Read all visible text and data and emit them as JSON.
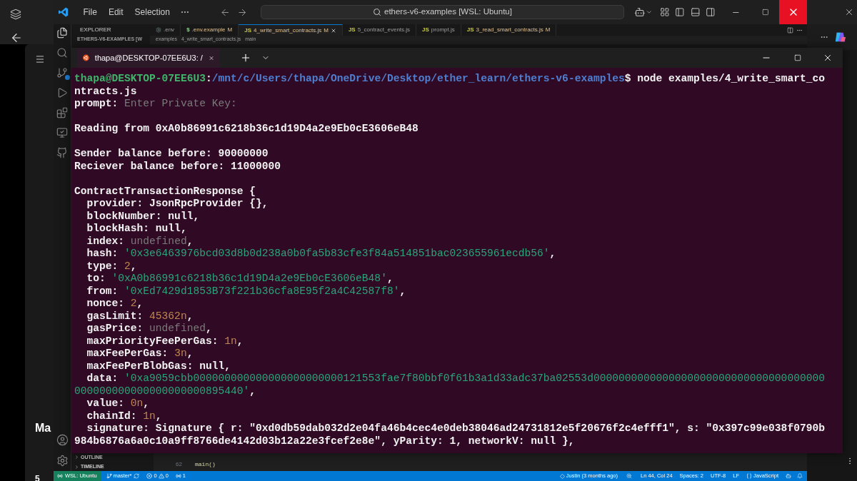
{
  "left_panel": {
    "heading": "Ma",
    "footer": "5"
  },
  "menu": [
    "File",
    "Edit",
    "Selection"
  ],
  "command_center": {
    "value": "ethers-v6-examples [WSL: Ubuntu]"
  },
  "sidebar": {
    "title": "EXPLORER",
    "folder": "ETHERS-V6-EXAMPLES [W",
    "sections": [
      "OUTLINE",
      "TIMELINE"
    ]
  },
  "editor_tabs": [
    {
      "label": ".env",
      "selected": false
    },
    {
      "label": ".env.example",
      "glyph": "$",
      "status": "M",
      "selected": false
    },
    {
      "label": "4_write_smart_contracts.js",
      "glyph": "JS",
      "status": "M",
      "selected": true
    },
    {
      "label": "5_contract_events.js",
      "glyph": "JS",
      "selected": false
    },
    {
      "label": "prompt.js",
      "glyph": "JS",
      "selected": false
    },
    {
      "label": "3_read_smart_contracts.js",
      "glyph": "JS",
      "status": "M",
      "selected": false
    }
  ],
  "breadcrumbs": [
    "examples",
    "4_write_smart_contracts.js",
    "main"
  ],
  "editor": {
    "line_number": "62",
    "code": "main()"
  },
  "terminal": {
    "tab_title": "thapa@DESKTOP-07EE6U3: /",
    "lines": [
      {
        "segments": [
          {
            "kind": "user",
            "text": "thapa@DESKTOP-07EE6U3"
          },
          {
            "kind": "plain",
            "text": ":"
          },
          {
            "kind": "path",
            "text": "/mnt/c/Users/thapa/OneDrive/Desktop/ether_learn/ethers-v6-examples"
          },
          {
            "kind": "plain",
            "text": "$ node examples/4_write_smart_co"
          }
        ]
      },
      {
        "segments": [
          {
            "kind": "plain",
            "text": "ntracts.js"
          }
        ]
      },
      {
        "segments": [
          {
            "kind": "plain",
            "text": "prompt: "
          },
          {
            "kind": "dim",
            "text": "Enter Private Key:"
          }
        ]
      },
      {
        "space_before": true,
        "segments": [
          {
            "kind": "plain",
            "text": "Reading from 0xA0b86991c6218b36c1d19D4a2e9Eb0cE3606eB48"
          }
        ]
      },
      {
        "space_before": true,
        "segments": [
          {
            "kind": "plain",
            "text": "Sender balance before: 90000000"
          }
        ]
      },
      {
        "segments": [
          {
            "kind": "plain",
            "text": "Reciever balance before: 11000000"
          }
        ]
      },
      {
        "space_before": true,
        "segments": [
          {
            "kind": "plain",
            "text": "ContractTransactionResponse {"
          }
        ]
      },
      {
        "segments": [
          {
            "kind": "plain",
            "text": "  provider: JsonRpcProvider {},"
          }
        ]
      },
      {
        "segments": [
          {
            "kind": "plain",
            "text": "  blockNumber: null,"
          }
        ]
      },
      {
        "segments": [
          {
            "kind": "plain",
            "text": "  blockHash: null,"
          }
        ]
      },
      {
        "segments": [
          {
            "kind": "plain",
            "text": "  index: "
          },
          {
            "kind": "dim",
            "text": "undefined"
          },
          {
            "kind": "plain",
            "text": ","
          }
        ]
      },
      {
        "segments": [
          {
            "kind": "plain",
            "text": "  hash: "
          },
          {
            "kind": "string",
            "text": "'0x3e6463976bcd03d8b0d238a0b0fa5b83cfe3f84a514851bac023655961ecdb56'"
          },
          {
            "kind": "plain",
            "text": ","
          }
        ]
      },
      {
        "segments": [
          {
            "kind": "plain",
            "text": "  type: "
          },
          {
            "kind": "number",
            "text": "2"
          },
          {
            "kind": "plain",
            "text": ","
          }
        ]
      },
      {
        "segments": [
          {
            "kind": "plain",
            "text": "  to: "
          },
          {
            "kind": "string",
            "text": "'0xA0b86991c6218b36c1d19D4a2e9Eb0cE3606eB48'"
          },
          {
            "kind": "plain",
            "text": ","
          }
        ]
      },
      {
        "segments": [
          {
            "kind": "plain",
            "text": "  from: "
          },
          {
            "kind": "string",
            "text": "'0xEd7429d1853B73f221b36cfa8E95f2a4C42587f8'"
          },
          {
            "kind": "plain",
            "text": ","
          }
        ]
      },
      {
        "segments": [
          {
            "kind": "plain",
            "text": "  nonce: "
          },
          {
            "kind": "number",
            "text": "2"
          },
          {
            "kind": "plain",
            "text": ","
          }
        ]
      },
      {
        "segments": [
          {
            "kind": "plain",
            "text": "  gasLimit: "
          },
          {
            "kind": "number",
            "text": "45362n"
          },
          {
            "kind": "plain",
            "text": ","
          }
        ]
      },
      {
        "segments": [
          {
            "kind": "plain",
            "text": "  gasPrice: "
          },
          {
            "kind": "dim",
            "text": "undefined"
          },
          {
            "kind": "plain",
            "text": ","
          }
        ]
      },
      {
        "segments": [
          {
            "kind": "plain",
            "text": "  maxPriorityFeePerGas: "
          },
          {
            "kind": "number",
            "text": "1n"
          },
          {
            "kind": "plain",
            "text": ","
          }
        ]
      },
      {
        "segments": [
          {
            "kind": "plain",
            "text": "  maxFeePerGas: "
          },
          {
            "kind": "number",
            "text": "3n"
          },
          {
            "kind": "plain",
            "text": ","
          }
        ]
      },
      {
        "segments": [
          {
            "kind": "plain",
            "text": "  maxFeePerBlobGas: null,"
          }
        ]
      },
      {
        "segments": [
          {
            "kind": "plain",
            "text": "  data: "
          },
          {
            "kind": "string",
            "text": "'0xa9059cbb000000000000000000000000121553fae7f80bbf0f61b3a1d33adc37ba02553d0000000000000000000000000000000000000"
          }
        ]
      },
      {
        "segments": [
          {
            "kind": "string",
            "text": "000000000000000000000895440'"
          },
          {
            "kind": "plain",
            "text": ","
          }
        ]
      },
      {
        "segments": [
          {
            "kind": "plain",
            "text": "  value: "
          },
          {
            "kind": "number",
            "text": "0n"
          },
          {
            "kind": "plain",
            "text": ","
          }
        ]
      },
      {
        "segments": [
          {
            "kind": "plain",
            "text": "  chainId: "
          },
          {
            "kind": "number",
            "text": "1n"
          },
          {
            "kind": "plain",
            "text": ","
          }
        ]
      },
      {
        "segments": [
          {
            "kind": "plain",
            "text": "  signature: Signature { r: \"0xd0db59dab032d2e04fa46b4cec4e0deb38046ad24731812e5f20676f2c4efff1\", s: \"0x397c99e038f0790b"
          }
        ]
      },
      {
        "segments": [
          {
            "kind": "plain",
            "text": "984b6876a6a0c10a9ff8766de4142d03b12a22e3fcef2e8e\", yParity: 1, networkV: null },"
          }
        ]
      }
    ]
  },
  "status_bar": {
    "remote": "WSL: Ubuntu",
    "branch": "master*",
    "errors": "0",
    "warnings": "0",
    "ports": "1",
    "blame": "Justin (3 months ago)",
    "cursor": "Ln 44, Col 24",
    "indent": "Spaces: 2",
    "encoding": "UTF-8",
    "eol": "LF",
    "language": "JavaScript"
  }
}
